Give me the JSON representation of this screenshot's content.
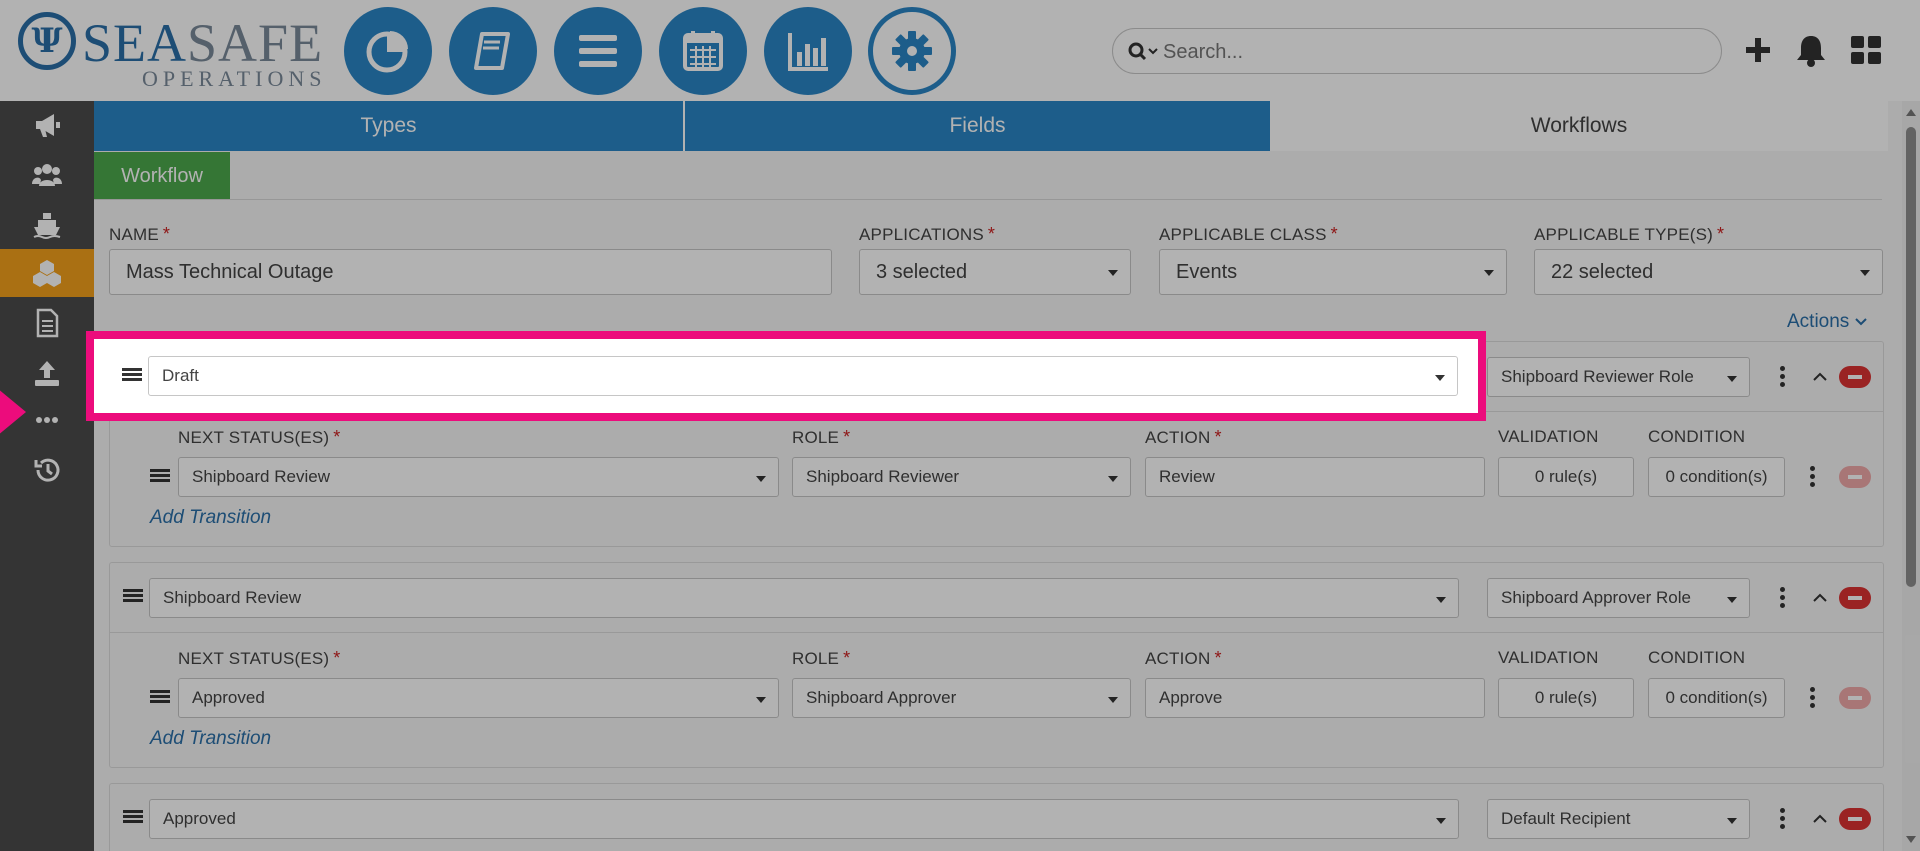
{
  "header": {
    "logo_sea": "SEA",
    "logo_safe": "SAFE",
    "logo_sub": "OPERATIONS",
    "nav_icons": [
      "pie-chart-icon",
      "book-icon",
      "list-icon",
      "calendar-icon",
      "bar-chart-icon",
      "gear-icon"
    ],
    "active_nav": "gear-icon",
    "search_placeholder": "Search...",
    "right_icons": [
      "plus-icon",
      "bell-icon",
      "grid-icon"
    ]
  },
  "sidebar": {
    "items": [
      "megaphone-icon",
      "users-icon",
      "ship-icon",
      "cubes-icon",
      "document-icon",
      "upload-icon",
      "more-icon",
      "history-icon"
    ],
    "active": "cubes-icon"
  },
  "tabs": [
    {
      "label": "Types",
      "active": false
    },
    {
      "label": "Fields",
      "active": false
    },
    {
      "label": "Workflows",
      "active": true
    }
  ],
  "subtab": "Workflow",
  "form": {
    "name_label": "NAME",
    "name_value": "Mass Technical Outage",
    "applications_label": "APPLICATIONS",
    "applications_value": "3 selected",
    "class_label": "APPLICABLE CLASS",
    "class_value": "Events",
    "types_label": "APPLICABLE TYPE(S)",
    "types_value": "22 selected",
    "required_mark": "*"
  },
  "actions_label": "Actions",
  "columns": {
    "next_status": "NEXT STATUS(ES)",
    "role": "ROLE",
    "action": "ACTION",
    "validation": "VALIDATION",
    "condition": "CONDITION"
  },
  "add_transition": "Add Transition",
  "statuses": [
    {
      "status": "Draft",
      "role_group": "Shipboard Reviewer Role",
      "transition": {
        "next": "Shipboard Review",
        "role": "Shipboard Reviewer",
        "action": "Review",
        "validation": "0 rule(s)",
        "condition": "0 condition(s)"
      }
    },
    {
      "status": "Shipboard Review",
      "role_group": "Shipboard Approver Role",
      "transition": {
        "next": "Approved",
        "role": "Shipboard Approver",
        "action": "Approve",
        "validation": "0 rule(s)",
        "condition": "0 condition(s)"
      }
    },
    {
      "status": "Approved",
      "role_group": "Default Recipient"
    }
  ],
  "colors": {
    "primary": "#2a86c6",
    "accent_orange": "#f4a11c",
    "subtab_green": "#4caa4c",
    "highlight": "#ec0c7c",
    "danger": "#dd3333"
  }
}
